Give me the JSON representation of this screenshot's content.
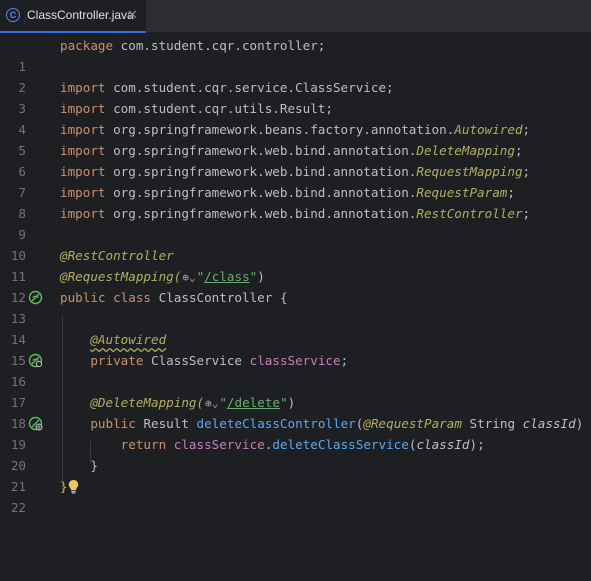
{
  "tab": {
    "title": "ClassController.java",
    "icon_letter": "C",
    "close_glyph": "✕"
  },
  "line_numbers": [
    "1",
    "2",
    "3",
    "4",
    "5",
    "6",
    "7",
    "8",
    "9",
    "10",
    "11",
    "12",
    "13",
    "14",
    "15",
    "16",
    "17",
    "18",
    "19",
    "20",
    "21",
    "22"
  ],
  "code": {
    "l1": {
      "kw": "package",
      "rest": " com.student.cqr.controller;"
    },
    "l3": {
      "kw": "import",
      "rest": " com.student.cqr.service.ClassService;"
    },
    "l4": {
      "kw": "import",
      "rest": " com.student.cqr.utils.Result;"
    },
    "l5": {
      "kw": "import",
      "rest": " org.springframework.beans.factory.annotation.",
      "ann": "Autowired",
      "end": ";"
    },
    "l6": {
      "kw": "import",
      "rest": " org.springframework.web.bind.annotation.",
      "ann": "DeleteMapping",
      "end": ";"
    },
    "l7": {
      "kw": "import",
      "rest": " org.springframework.web.bind.annotation.",
      "ann": "RequestMapping",
      "end": ";"
    },
    "l8": {
      "kw": "import",
      "rest": " org.springframework.web.bind.annotation.",
      "ann": "RequestParam",
      "end": ";"
    },
    "l9": {
      "kw": "import",
      "rest": " org.springframework.web.bind.annotation.",
      "ann": "RestController",
      "end": ";"
    },
    "l11": {
      "ann": "@RestController"
    },
    "l12": {
      "ann": "@RequestMapping(",
      "globe": "⊕⌄",
      "q1": "\"",
      "url": "/class",
      "q2": "\"",
      "end": ")"
    },
    "l13": {
      "kw1": "public",
      "kw2": "class",
      "cls": "ClassController",
      "brace": "{"
    },
    "l15": {
      "ann": "@Autowired"
    },
    "l16": {
      "kw": "private",
      "type": "ClassService",
      "field": "classService",
      "end": ";"
    },
    "l18": {
      "ann": "@DeleteMapping(",
      "globe": "⊕⌄",
      "q1": "\"",
      "url": "/delete",
      "q2": "\"",
      "end": ")"
    },
    "l19": {
      "kw": "public",
      "type": "Result",
      "fn": "deleteClassController",
      "p1": "(",
      "ann": "@RequestParam",
      "ptype": "String",
      "param": "classId",
      "p2": ")",
      "brace": "{"
    },
    "l20": {
      "kw": "return",
      "field": "classService",
      "dot": ".",
      "fn": "deleteClassService",
      "p1": "(",
      "param": "classId",
      "p2": ");"
    },
    "l21": {
      "brace": "}"
    },
    "l22": {
      "brace": "}"
    }
  },
  "colors": {
    "background": "#1e1f22",
    "keyword": "#cf8e6d",
    "annotation": "#b3ae60",
    "method": "#56a8f5",
    "field": "#c77dbb",
    "string": "#6aab73",
    "line_number": "#6f737a",
    "tab_accent": "#3574f0",
    "bean_icon": "#5fb85f",
    "bulb": "#f2c55c"
  },
  "icons": {
    "tab": "java-class-icon",
    "gutter_13": "spring-bean-icon",
    "gutter_16": "spring-bean-icon",
    "gutter_19": "spring-endpoint-icon",
    "line_22": "lightbulb-icon"
  }
}
